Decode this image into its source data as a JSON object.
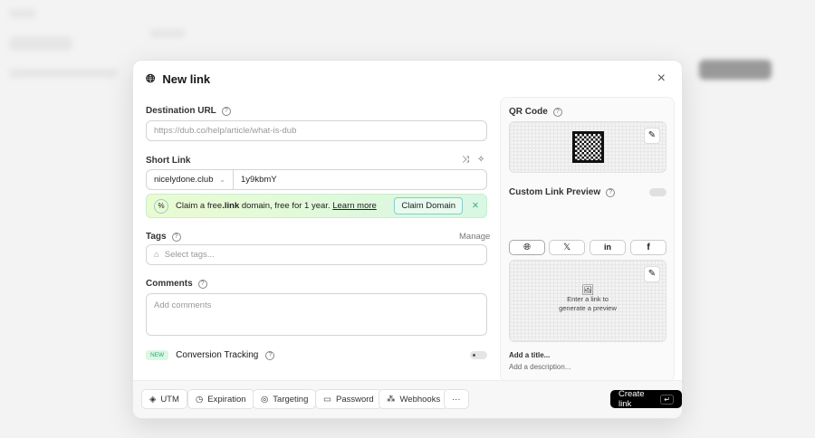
{
  "header": {
    "title": "New link",
    "close": "×"
  },
  "destination": {
    "label": "Destination URL",
    "placeholder": "https://dub.co/help/article/what-is-dub"
  },
  "short_link": {
    "label": "Short Link",
    "domain": "nicelydone.club",
    "key": "1y9kbmY"
  },
  "promo": {
    "text_before": "Claim a free ",
    "bold": ".link",
    "text_after": " domain, free for 1 year. ",
    "link": "Learn more",
    "button": "Claim Domain"
  },
  "tags": {
    "label": "Tags",
    "manage": "Manage",
    "placeholder": "Select tags..."
  },
  "comments": {
    "label": "Comments",
    "placeholder": "Add comments"
  },
  "conversion": {
    "badge": "NEW",
    "label": "Conversion Tracking",
    "enabled": false
  },
  "qr": {
    "label": "QR Code"
  },
  "preview": {
    "label": "Custom Link Preview",
    "enabled": false,
    "tabs": [
      "web",
      "x",
      "linkedin",
      "facebook"
    ],
    "empty_line1": "Enter a link to",
    "empty_line2": "generate a preview",
    "title_placeholder": "Add a title...",
    "description_placeholder": "Add a description..."
  },
  "footer": {
    "buttons": [
      "UTM",
      "Expiration",
      "Targeting",
      "Password",
      "Webhooks"
    ],
    "more": "···",
    "create": "Create link",
    "shortcut": "↵"
  }
}
